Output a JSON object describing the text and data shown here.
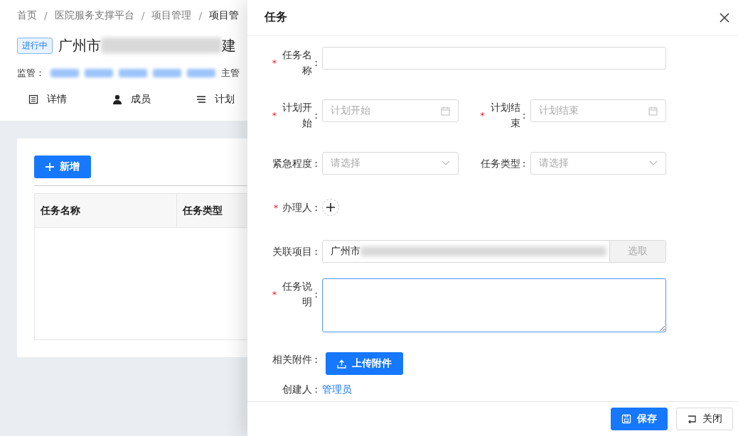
{
  "breadcrumb": [
    {
      "label": "首页",
      "current": false
    },
    {
      "label": "医院服务支撑平台",
      "current": false
    },
    {
      "label": "项目管理",
      "current": false
    },
    {
      "label": "项目管",
      "current": true
    }
  ],
  "breadcrumb_separator": "/",
  "project": {
    "status": "进行中",
    "title_start": "广州市",
    "title_end": "建",
    "supervisor_label": "监管：",
    "manager_label": "主管"
  },
  "tabs": [
    {
      "label": "详情"
    },
    {
      "label": "成员"
    },
    {
      "label": "计划"
    }
  ],
  "toolbar": {
    "add_button": "新增"
  },
  "table": {
    "columns": [
      "任务名称",
      "任务类型"
    ]
  },
  "drawer": {
    "title": "任务",
    "required_mark": "*",
    "rows": [
      {
        "fields": [
          {
            "kind": "text",
            "label": "任务名称",
            "required": true,
            "colon": ":",
            "focused": false
          }
        ]
      },
      {
        "fields": [
          {
            "kind": "date",
            "label": "计划开始",
            "required": true,
            "colon": ":",
            "placeholder": "计划开始"
          },
          {
            "kind": "date",
            "label": "计划结束",
            "required": true,
            "colon": ":",
            "placeholder": "计划结束"
          }
        ]
      },
      {
        "fields": [
          {
            "kind": "select",
            "label": "紧急程度",
            "required": false,
            "colon": ":",
            "placeholder": "请选择"
          },
          {
            "kind": "select",
            "label": "任务类型",
            "required": false,
            "colon": ":",
            "placeholder": "请选择"
          }
        ]
      },
      {
        "fields": [
          {
            "kind": "assignee",
            "label": "办理人",
            "required": true,
            "colon": ":"
          }
        ]
      },
      {
        "fields": [
          {
            "kind": "picker",
            "label": "关联项目",
            "required": false,
            "colon": ":",
            "value": "广州市",
            "button": "选取"
          }
        ]
      },
      {
        "fields": [
          {
            "kind": "textarea",
            "label": "任务说明",
            "required": true,
            "colon": ":",
            "focused": true
          }
        ]
      },
      {
        "fields": [
          {
            "kind": "upload",
            "label": "相关附件",
            "required": false,
            "colon": ":",
            "button": "上传附件"
          }
        ]
      },
      {
        "fields": [
          {
            "kind": "creator",
            "label": "创建人",
            "required": false,
            "colon": ":",
            "value": "管理员"
          }
        ]
      }
    ],
    "footer": [
      {
        "label": "保存",
        "kind": "primary"
      },
      {
        "label": "关闭",
        "kind": "default"
      }
    ]
  }
}
